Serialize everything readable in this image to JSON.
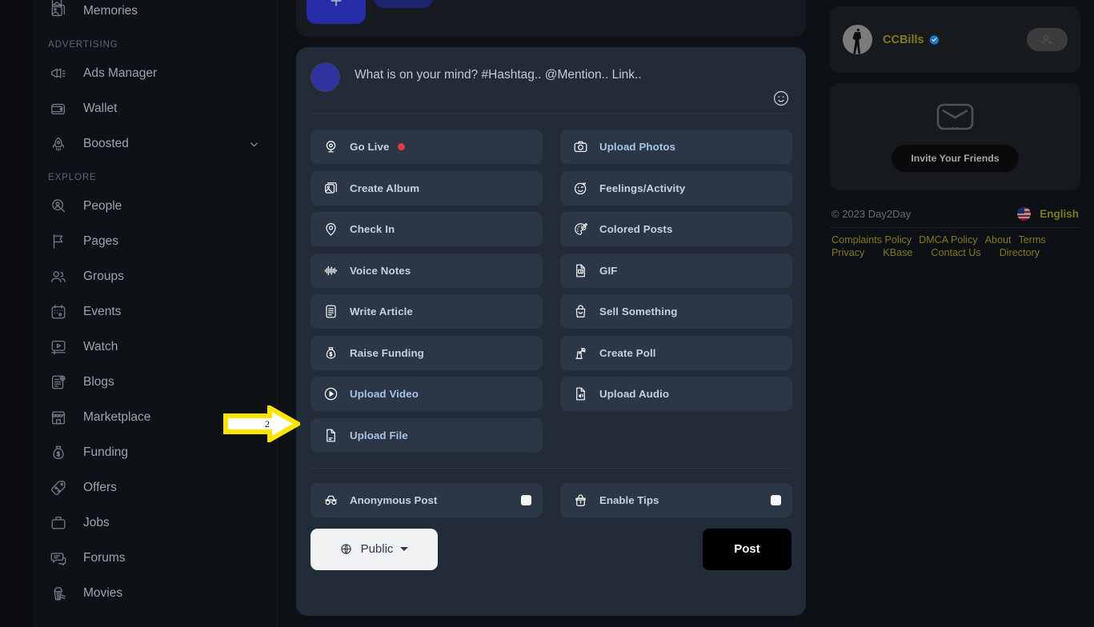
{
  "sidebar": {
    "groups": [
      {
        "label": "",
        "items": [
          {
            "label": "Memories",
            "icon": "memories-icon",
            "caret": false
          }
        ]
      },
      {
        "label": "ADVERTISING",
        "items": [
          {
            "label": "Ads Manager",
            "icon": "megaphone-icon",
            "caret": false
          },
          {
            "label": "Wallet",
            "icon": "wallet-icon",
            "caret": false
          },
          {
            "label": "Boosted",
            "icon": "rocket-icon",
            "caret": true
          }
        ]
      },
      {
        "label": "EXPLORE",
        "items": [
          {
            "label": "People",
            "icon": "people-search-icon",
            "caret": false
          },
          {
            "label": "Pages",
            "icon": "flag-icon",
            "caret": false
          },
          {
            "label": "Groups",
            "icon": "groups-icon",
            "caret": false
          },
          {
            "label": "Events",
            "icon": "calendar-icon",
            "caret": false
          },
          {
            "label": "Watch",
            "icon": "video-player-icon",
            "caret": false
          },
          {
            "label": "Blogs",
            "icon": "article-icon",
            "caret": false
          },
          {
            "label": "Marketplace",
            "icon": "store-icon",
            "caret": false
          },
          {
            "label": "Funding",
            "icon": "money-bag-icon",
            "caret": false
          },
          {
            "label": "Offers",
            "icon": "discount-tag-icon",
            "caret": false
          },
          {
            "label": "Jobs",
            "icon": "briefcase-icon",
            "caret": false
          },
          {
            "label": "Forums",
            "icon": "chat-bubbles-icon",
            "caret": false
          },
          {
            "label": "Movies",
            "icon": "popcorn-icon",
            "caret": false
          }
        ]
      }
    ]
  },
  "composer": {
    "placeholder": "What is on your mind? #Hashtag.. @Mention.. Link..",
    "emoji_icon": "smiley-icon",
    "options_left": [
      {
        "label": "Go Live",
        "icon": "webcam-icon",
        "accent": false,
        "dot": true
      },
      {
        "label": "Create Album",
        "icon": "image-stack-icon",
        "accent": false,
        "dot": false
      },
      {
        "label": "Check In",
        "icon": "map-pin-icon",
        "accent": false,
        "dot": false
      },
      {
        "label": "Voice Notes",
        "icon": "waveform-icon",
        "accent": false,
        "dot": false
      },
      {
        "label": "Write Article",
        "icon": "document-lines-icon",
        "accent": false,
        "dot": false
      },
      {
        "label": "Raise Funding",
        "icon": "money-bag-icon",
        "accent": false,
        "dot": false
      },
      {
        "label": "Upload Video",
        "icon": "play-circle-icon",
        "accent": true,
        "dot": false
      },
      {
        "label": "Upload File",
        "icon": "file-icon",
        "accent": true,
        "dot": false
      }
    ],
    "options_right": [
      {
        "label": "Upload Photos",
        "icon": "camera-icon",
        "accent": true,
        "dot": false
      },
      {
        "label": "Feelings/Activity",
        "icon": "smiley-wink-icon",
        "accent": false,
        "dot": false
      },
      {
        "label": "Colored Posts",
        "icon": "palette-brush-icon",
        "accent": false,
        "dot": false
      },
      {
        "label": "GIF",
        "icon": "gif-file-icon",
        "accent": false,
        "dot": false
      },
      {
        "label": "Sell Something",
        "icon": "shopping-bag-icon",
        "accent": false,
        "dot": false
      },
      {
        "label": "Create Poll",
        "icon": "poll-icon",
        "accent": false,
        "dot": false
      },
      {
        "label": "Upload Audio",
        "icon": "audio-file-icon",
        "accent": false,
        "dot": false
      }
    ],
    "toggles": [
      {
        "label": "Anonymous Post",
        "icon": "incognito-icon",
        "checked": false
      },
      {
        "label": "Enable Tips",
        "icon": "tip-jar-icon",
        "checked": false
      }
    ],
    "privacy": {
      "label": "Public",
      "icon": "globe-icon"
    },
    "post_button": "Post"
  },
  "right": {
    "profile": {
      "name": "CCBills",
      "verified_icon": "verified-badge-icon",
      "add_friend_icon": "add-user-icon"
    },
    "invite": {
      "icon": "envelope-icon",
      "button": "Invite Your Friends"
    },
    "footer": {
      "copyright": "© 2023 Day2Day",
      "language": "English",
      "flag_icon": "us-flag-icon",
      "links": [
        "Complaints Policy",
        "DMCA Policy",
        "About",
        "Terms",
        "Privacy",
        "KBase",
        "Contact Us",
        "Directory"
      ]
    }
  },
  "annotation": {
    "number": "2",
    "arrow_color": "#ffe400"
  }
}
